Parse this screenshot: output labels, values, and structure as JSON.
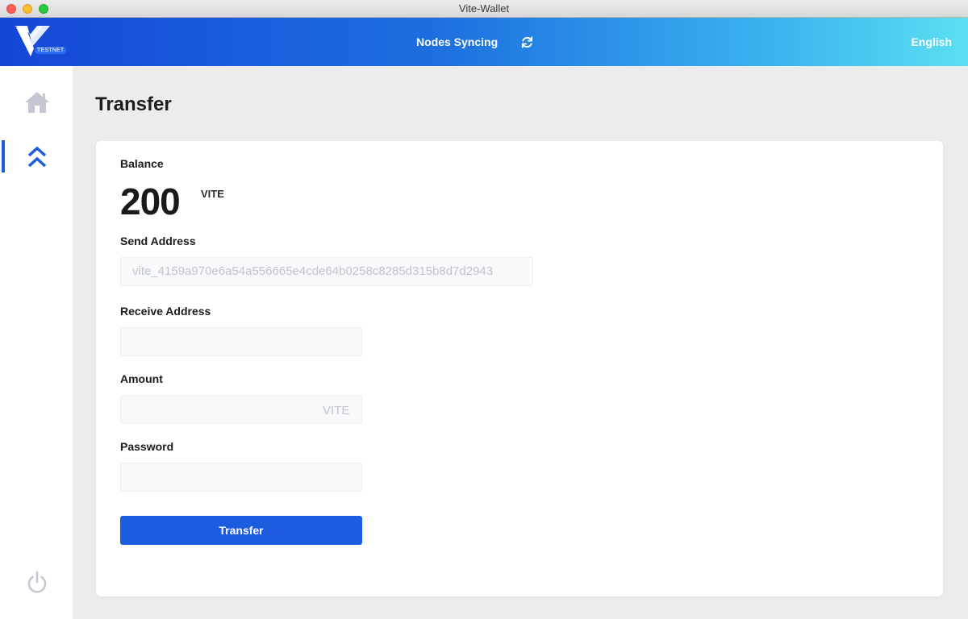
{
  "window": {
    "title": "Vite-Wallet"
  },
  "header": {
    "logo_badge": "TESTNET",
    "sync_status": "Nodes Syncing",
    "language": "English",
    "refresh_icon": "refresh-icon"
  },
  "sidebar": {
    "items": [
      {
        "name": "home",
        "icon": "home-icon",
        "active": false
      },
      {
        "name": "transfer",
        "icon": "double-chevron-up-icon",
        "active": true
      },
      {
        "name": "logout",
        "icon": "power-icon",
        "active": false
      }
    ]
  },
  "page": {
    "title": "Transfer"
  },
  "form": {
    "balance_label": "Balance",
    "balance_value": "200",
    "balance_unit": "VITE",
    "send_address_label": "Send Address",
    "send_address_value": "vite_4159a970e6a54a556665e4cde64b0258c8285d315b8d7d2943",
    "receive_address_label": "Receive Address",
    "receive_address_value": "",
    "amount_label": "Amount",
    "amount_value": "",
    "amount_unit": "VITE",
    "password_label": "Password",
    "password_value": "",
    "submit_label": "Transfer"
  },
  "colors": {
    "accent": "#1b5ce0",
    "header_gradient_start": "#1546d6",
    "header_gradient_end": "#5bdff2",
    "sidebar_inactive_icon": "#c5c8d3"
  }
}
